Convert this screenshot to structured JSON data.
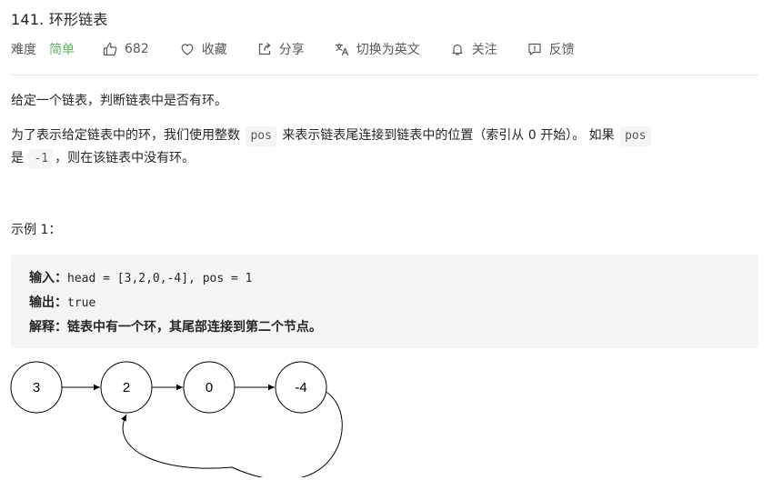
{
  "problem": {
    "title": "141. 环形链表"
  },
  "meta": {
    "difficulty_label": "难度",
    "difficulty_value": "简单",
    "likes": "682",
    "favorite_label": "收藏",
    "share_label": "分享",
    "translate_label": "切换为英文",
    "follow_label": "关注",
    "feedback_label": "反馈",
    "difficulty_color": "#5cb85c"
  },
  "description": {
    "p1": "给定一个链表，判断链表中是否有环。",
    "p2_part1": "为了表示给定链表中的环，我们使用整数 ",
    "p2_code1": "pos",
    "p2_part2": " 来表示链表尾连接到链表中的位置（索引从 0 开始）。 如果 ",
    "p2_code2": "pos",
    "p2_part3": " 是 ",
    "p2_code3": "-1",
    "p2_part4": "，则在该链表中没有环。"
  },
  "example": {
    "title": "示例 1：",
    "input_label": "输入：",
    "input_value": "head = [3,2,0,-4], pos = 1",
    "output_label": "输出：",
    "output_value": "true",
    "explain_label": "解释：",
    "explain_value": "链表中有一个环，其尾部连接到第二个节点。"
  },
  "diagram": {
    "nodes": [
      "3",
      "2",
      "0",
      "-4"
    ],
    "cycle_from_index": 3,
    "cycle_to_index": 1
  }
}
